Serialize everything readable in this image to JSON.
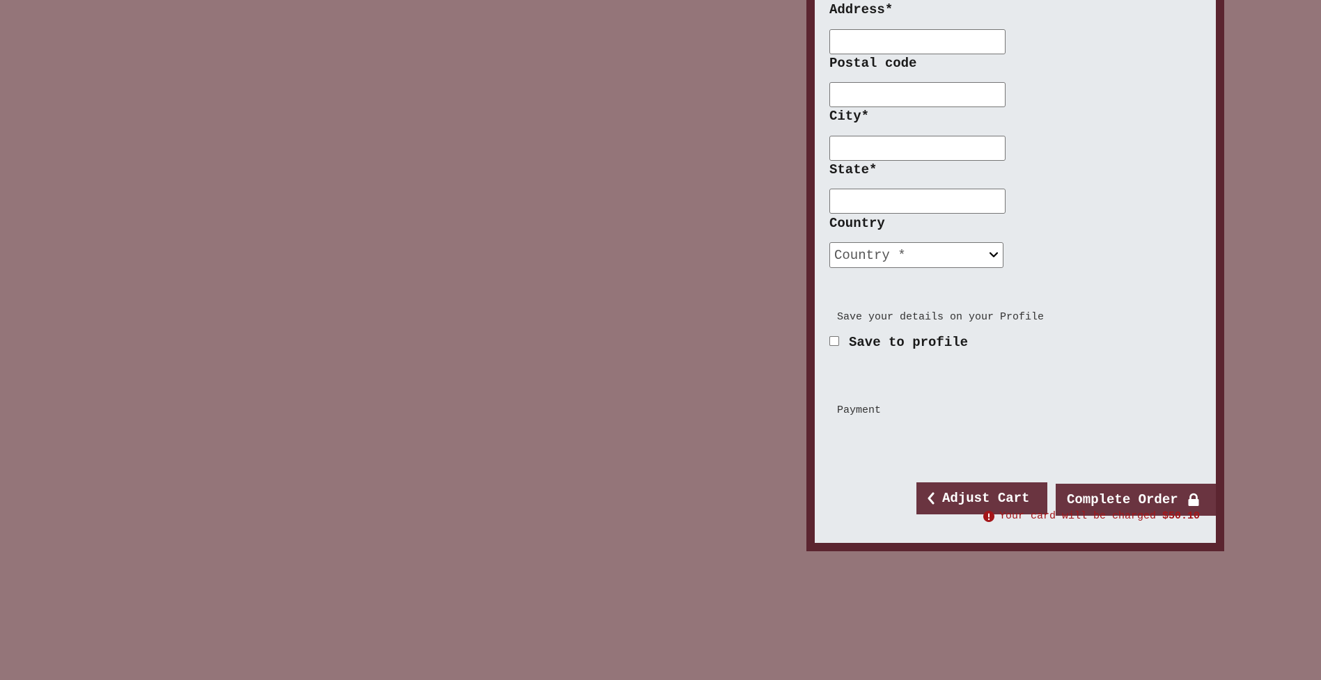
{
  "form": {
    "fields": [
      {
        "label": "Address*",
        "value": ""
      },
      {
        "label": "Postal code",
        "value": ""
      },
      {
        "label": "City*",
        "value": ""
      },
      {
        "label": "State*",
        "value": ""
      }
    ],
    "country": {
      "label": "Country",
      "selected": "Country *"
    }
  },
  "save_section": {
    "heading": "Save your details on your Profile",
    "checkbox_label": "Save to profile",
    "checked": false
  },
  "payment": {
    "heading": "Payment"
  },
  "actions": {
    "adjust_cart_label": "Adjust Cart",
    "complete_order_label": "Complete Order",
    "charge_note": "Your card will be charged",
    "charge_amount": "$50.10"
  },
  "colors": {
    "page_background": "#947579",
    "panel_border": "#5b2530",
    "panel_background": "#e7eaed",
    "button": "#6a3440",
    "warning": "#a4161a"
  },
  "icons": {
    "adjust_cart": "chevron-left-icon",
    "complete_order": "lock-icon",
    "charge_note": "exclamation-circle-icon",
    "select": "chevron-down-icon"
  }
}
